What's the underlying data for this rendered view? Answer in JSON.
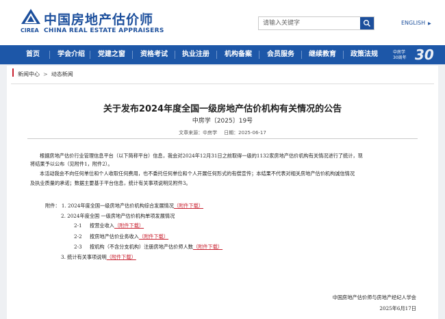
{
  "header": {
    "logo_cn": "中国房地产估价师",
    "logo_abbr": "CIREA",
    "logo_en": "CHINA REAL ESTATE APPRAISERS",
    "brand_color": "#1c4f9c"
  },
  "search": {
    "placeholder": "请输入关键字",
    "icon": "search-icon"
  },
  "language": {
    "label": "ENGLISH"
  },
  "nav": {
    "background": "#1d57a8",
    "items": [
      "首页",
      "学会介绍",
      "党建之窗",
      "资格考试",
      "执业注册",
      "机构备案",
      "会员服务",
      "继续教育",
      "政策法规"
    ],
    "badge_small_line1": "中房学",
    "badge_small_line2": "30周年",
    "badge_number": "30"
  },
  "breadcrumb": {
    "items": [
      "新闻中心",
      "动态新闻"
    ],
    "separator": ">"
  },
  "article": {
    "title": "关于发布2024年度全国一级房地产估价机构有关情况的公告",
    "doc_number": "中房学〔2025〕19号",
    "source_label": "文章来源：中房学",
    "date_label": "日期：2025-06-17",
    "para1_line1_a": "根据房地产估价行业管理信息平台（以下简称平台）信息，我会对2024年12月31日之前取得一级的1132家房地产估价机构有关情况进行了统计，现",
    "para1_line2": "将结果予以公布（见附件1，附件2）。",
    "para2_line1_a": "本活动我会不向任何单位和个人收取任何费用，也不委托任何单位和个人开展任何形式的有偿宣传；",
    "para2_line1_b": "本结果不代表对相关房地产估价机构诚信情况",
    "para2_line2": "及执业质量的承诺；数据主要基于平台信息，统计有关事项说明见附件3。",
    "attachments_label": "附件：",
    "attachments": [
      {
        "num": "1.",
        "text": "2024年度全国一级房地产估价机构综合发展情况",
        "link": "（附件下载）"
      },
      {
        "num": "2.",
        "text": "2024年度全国  一级房地产估价机构单项发展情况",
        "link": ""
      },
      {
        "num": "2-1",
        "text": "按营业收入",
        "link": "（附件下载）"
      },
      {
        "num": "2-2",
        "text": "按房地产估价业务收入",
        "link": "（附件下载）"
      },
      {
        "num": "2-3",
        "text": "按机构（不含分支机构）注册房地产估价师人数",
        "link": "（附件下载）"
      },
      {
        "num": "3.",
        "text": "统计有关事项说明",
        "link": "（附件下载）"
      }
    ],
    "signature": "中国房地产估价师与房地产经纪人学会",
    "sign_date": "2025年6月17日"
  }
}
